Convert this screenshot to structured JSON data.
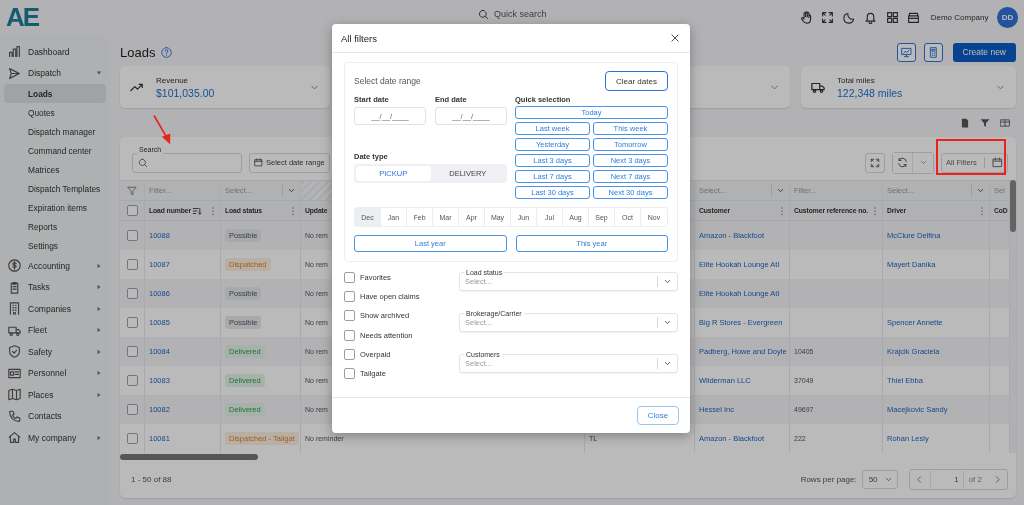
{
  "header": {
    "logo": "AE",
    "search_placeholder": "Quick search",
    "company": "Demo Company",
    "avatar": "DD"
  },
  "sidebar": {
    "items": [
      {
        "label": "Dashboard",
        "selected": false
      },
      {
        "label": "Dispatch",
        "selected": false,
        "expanded": true,
        "children": [
          {
            "label": "Loads",
            "selected": true
          },
          {
            "label": "Quotes",
            "selected": false
          },
          {
            "label": "Dispatch manager",
            "selected": false
          },
          {
            "label": "Command center",
            "selected": false
          },
          {
            "label": "Matrices",
            "selected": false
          },
          {
            "label": "Dispatch Templates",
            "selected": false
          },
          {
            "label": "Expiration items",
            "selected": false
          },
          {
            "label": "Reports",
            "selected": false
          },
          {
            "label": "Settings",
            "selected": false
          }
        ]
      },
      {
        "label": "Accounting",
        "selected": false,
        "expanded": false
      },
      {
        "label": "Tasks",
        "selected": false,
        "expanded": false
      },
      {
        "label": "Companies",
        "selected": false,
        "expanded": false
      },
      {
        "label": "Fleet",
        "selected": false,
        "expanded": false
      },
      {
        "label": "Safety",
        "selected": false,
        "expanded": false
      },
      {
        "label": "Personnel",
        "selected": false,
        "expanded": false
      },
      {
        "label": "Places",
        "selected": false,
        "expanded": false
      },
      {
        "label": "Contacts",
        "selected": false
      },
      {
        "label": "My company",
        "selected": false,
        "expanded": false
      }
    ]
  },
  "page": {
    "title": "Loads",
    "create_button": "Create new",
    "stat_cards": [
      {
        "kind": "metric",
        "label": "Revenue",
        "value": "$101,035.00"
      },
      {
        "kind": "blank"
      },
      {
        "kind": "metric",
        "label": "Total miles",
        "value": "122,348 miles"
      }
    ],
    "toolbar": {
      "search_label": "Search",
      "date_range": "Select date range",
      "all_filters": "All Filters"
    },
    "table": {
      "all_selected": false,
      "columns": [
        {
          "label": "Load number",
          "sorted": true,
          "menu": true,
          "filter": {
            "kind": "text",
            "placeholder": "Filter..."
          }
        },
        {
          "label": "Load status",
          "sorted": false,
          "menu": true,
          "filter": {
            "kind": "select",
            "placeholder": "Select..."
          }
        },
        {
          "label": "Update",
          "filter": {
            "kind": "hatched"
          }
        },
        {
          "filter": {
            "kind": "none"
          }
        },
        {
          "label": "Customer",
          "sorted": false,
          "menu": true,
          "filter": {
            "kind": "select",
            "placeholder": "Select..."
          }
        },
        {
          "label": "Customer reference no.",
          "sorted": false,
          "menu": true,
          "filter": {
            "kind": "text",
            "placeholder": "Filter..."
          }
        },
        {
          "label": "Driver",
          "sorted": false,
          "menu": true,
          "filter": {
            "kind": "select",
            "placeholder": "Select..."
          }
        },
        {
          "label": "CoD",
          "filter": {
            "kind": "text",
            "placeholder": "Sel"
          }
        }
      ],
      "rows": [
        {
          "selected": false,
          "load_number": "10088",
          "status": {
            "label": "Possible",
            "kind": "neutral"
          },
          "update": "No rem",
          "customer": "Amazon - Blackfoot",
          "driver": "McClure Delfina"
        },
        {
          "selected": false,
          "load_number": "10087",
          "status": {
            "label": "Dispatched",
            "kind": "warning"
          },
          "update": "No rem",
          "customer": "Elite Hookah Lounge Atl",
          "driver": "Mayert Danika"
        },
        {
          "selected": false,
          "load_number": "10086",
          "status": {
            "label": "Possible",
            "kind": "neutral"
          },
          "update": "No rem",
          "customer": "Elite Hookah Lounge Atl"
        },
        {
          "selected": false,
          "load_number": "10085",
          "status": {
            "label": "Possible",
            "kind": "neutral"
          },
          "update": "No rem",
          "customer": "Big R Stores - Evergreen",
          "driver": "Spencer Annette"
        },
        {
          "selected": false,
          "load_number": "10084",
          "status": {
            "label": "Delivered",
            "kind": "success"
          },
          "update": "No rem",
          "customer": "Padberg, Howe and Doyle",
          "customer_reference": "10405",
          "driver": "Krajcik Graciela"
        },
        {
          "selected": false,
          "load_number": "10083",
          "status": {
            "label": "Delivered",
            "kind": "success"
          },
          "update": "No rem",
          "customer": "Wilderman LLC",
          "customer_reference": "37049",
          "driver": "Thiel Ebba"
        },
        {
          "selected": false,
          "load_number": "10082",
          "status": {
            "label": "Delivered",
            "kind": "success"
          },
          "update": "No rem",
          "customer": "Hessel Inc",
          "customer_reference": "49697",
          "driver": "Macejkovic Sandy"
        },
        {
          "selected": false,
          "load_number": "10081",
          "status": {
            "label": "Dispatched - Tailgat",
            "kind": "warning"
          },
          "update": "No reminder",
          "column_5": "TL",
          "customer": "Amazon - Blackfoot",
          "customer_reference": "222",
          "driver": "Rohan Lesly"
        }
      ]
    },
    "footer": {
      "range": "1 - 50 of 88",
      "rows_label": "Rows per page:",
      "rows_per_page": "50",
      "page": "1",
      "page_total": "of 2"
    }
  },
  "modal": {
    "title": "All filters",
    "date_range": {
      "title": "Select date range",
      "clear": "Clear dates",
      "start_label": "Start date",
      "start_placeholder": "__/__/____",
      "end_label": "End date",
      "end_placeholder": "__/__/____",
      "quick_label": "Quick selection",
      "quick": [
        "Today",
        "Last week",
        "This week",
        "Yesterday",
        "Tomorrow",
        "Last 3 days",
        "Next 3 days",
        "Last 7 days",
        "Next 7 days",
        "Last 30 days",
        "Next 30 days"
      ],
      "date_type_label": "Date type",
      "date_types": [
        {
          "label": "PICKUP",
          "selected": true
        },
        {
          "label": "DELIVERY",
          "selected": false
        }
      ],
      "months": [
        {
          "label": "Dec",
          "selected": true
        },
        {
          "label": "Jan",
          "selected": false
        },
        {
          "label": "Feb",
          "selected": false
        },
        {
          "label": "Mar",
          "selected": false
        },
        {
          "label": "Apr",
          "selected": false
        },
        {
          "label": "May",
          "selected": false
        },
        {
          "label": "Jun",
          "selected": false
        },
        {
          "label": "Jul",
          "selected": false
        },
        {
          "label": "Aug",
          "selected": false
        },
        {
          "label": "Sep",
          "selected": false
        },
        {
          "label": "Oct",
          "selected": false
        },
        {
          "label": "Nov",
          "selected": false
        }
      ],
      "years": [
        "Last year",
        "This year"
      ]
    },
    "checkboxes": [
      {
        "label": "Favorites",
        "checked": false
      },
      {
        "label": "Have open claims",
        "checked": false
      },
      {
        "label": "Show archived",
        "checked": false
      },
      {
        "label": "Needs attention",
        "checked": false
      },
      {
        "label": "Overpaid",
        "checked": false
      },
      {
        "label": "Tailgate",
        "checked": false
      }
    ],
    "selects": [
      {
        "label": "Load status",
        "placeholder": "Select..."
      },
      {
        "label": "Brokerage/Carrier",
        "placeholder": "Select..."
      },
      {
        "label": "Customers",
        "placeholder": "Select..."
      }
    ],
    "close_button": "Close"
  }
}
